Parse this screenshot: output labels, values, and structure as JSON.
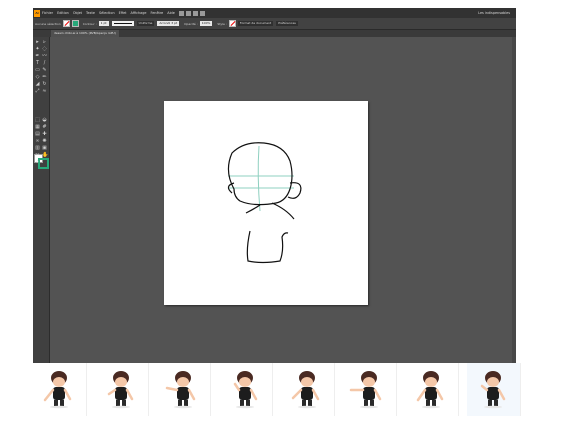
{
  "menubar": {
    "app_logo": "Ai",
    "items": [
      "Fichier",
      "Edition",
      "Objet",
      "Texte",
      "Sélection",
      "Effet",
      "Affichage",
      "Fenêtre",
      "Aide"
    ],
    "workspace": "Les indispensables"
  },
  "controlbar": {
    "selection_label": "Aucune sélection",
    "stroke_label": "Contour :",
    "stroke_weight": "1 pt",
    "uniform_label": "Uniforme",
    "brush_label": "Arrondi 3 pt",
    "opacity_label": "Opacité :",
    "opacity_value": "100%",
    "style_label": "Style :",
    "doc_setup_button": "Format de document",
    "prefs_button": "Préférences"
  },
  "document_tab": {
    "title": "dessin chibi.ai à 100% (RVB/Aperçu GPU)"
  },
  "tools": [
    "selection-tool",
    "direct-selection-tool",
    "magic-wand-tool",
    "lasso-tool",
    "pen-tool",
    "curvature-tool",
    "type-tool",
    "line-tool",
    "rectangle-tool",
    "paintbrush-tool",
    "shaper-tool",
    "pencil-tool",
    "eraser-tool",
    "rotate-tool",
    "scale-tool",
    "width-tool",
    "free-transform-tool",
    "shape-builder-tool",
    "perspective-tool",
    "mesh-tool",
    "gradient-tool",
    "eyedropper-tool",
    "blend-tool",
    "symbol-sprayer-tool",
    "graph-tool",
    "artboard-tool",
    "slice-tool",
    "hand-tool",
    "zoom-tool"
  ],
  "colors": {
    "stroke": "#27a87a",
    "fill": "#ffffff",
    "guide_lines": "#8fd0c0",
    "ui_dark": "#535353"
  },
  "thumbnails": {
    "count": 8,
    "selected_index": 7,
    "subject": "chibi-character-pose"
  }
}
